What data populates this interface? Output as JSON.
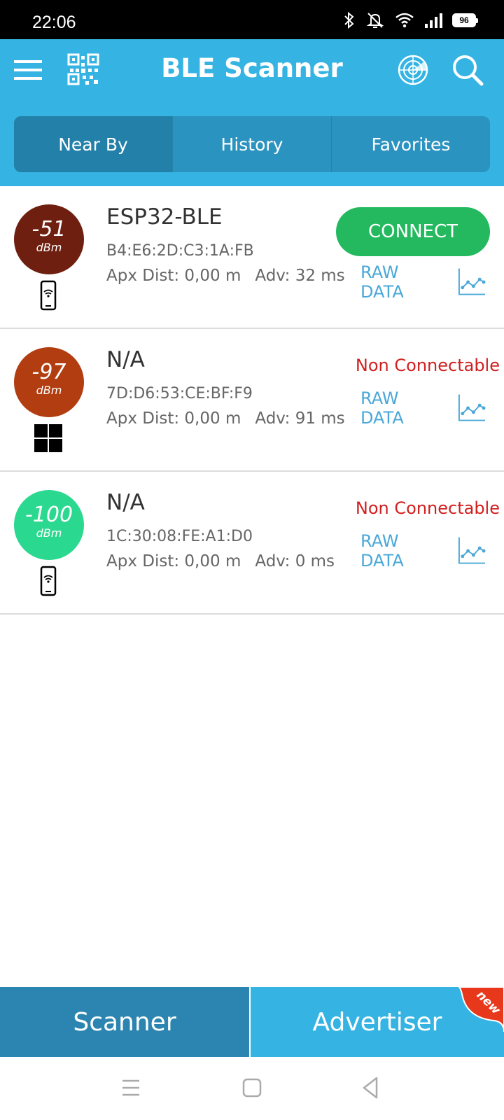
{
  "status_bar": {
    "time": "22:06",
    "battery": "96"
  },
  "app_bar": {
    "title": "BLE Scanner"
  },
  "tabs": [
    {
      "label": "Near By",
      "active": true
    },
    {
      "label": "History",
      "active": false
    },
    {
      "label": "Favorites",
      "active": false
    }
  ],
  "devices": [
    {
      "rssi": "-51",
      "rssi_unit": "dBm",
      "rssi_color": "#6e1f10",
      "device_type": "phone",
      "name": "ESP32-BLE",
      "mac": "B4:E6:2D:C3:1A:FB",
      "distance": "Apx Dist: 0,00 m",
      "adv": "Adv: 32 ms",
      "action": "CONNECT",
      "raw_label": "RAW DATA"
    },
    {
      "rssi": "-97",
      "rssi_unit": "dBm",
      "rssi_color": "#b13d10",
      "device_type": "windows",
      "name": "N/A",
      "mac": "7D:D6:53:CE:BF:F9",
      "distance": "Apx Dist: 0,00 m",
      "adv": "Adv: 91 ms",
      "action": "Non Connectable",
      "raw_label": "RAW DATA"
    },
    {
      "rssi": "-100",
      "rssi_unit": "dBm",
      "rssi_color": "#2ad88f",
      "device_type": "phone",
      "name": "N/A",
      "mac": "1C:30:08:FE:A1:D0",
      "distance": "Apx Dist: 0,00 m",
      "adv": "Adv: 0 ms",
      "action": "Non Connectable",
      "raw_label": "RAW DATA"
    }
  ],
  "bottom_bar": {
    "scanner": "Scanner",
    "advertiser": "Advertiser",
    "badge": "new"
  },
  "colors": {
    "primary": "#35b4e3",
    "connect": "#24b95f",
    "non_connectable": "#d11f1f",
    "raw_data": "#4aa8d8"
  }
}
